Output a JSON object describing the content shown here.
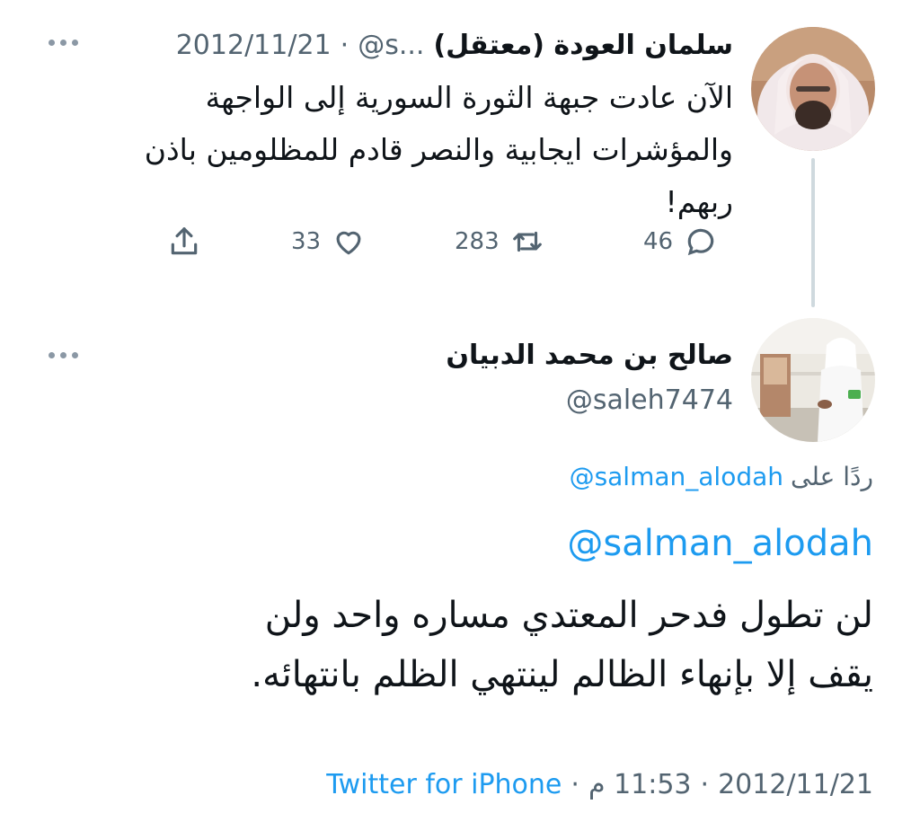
{
  "parent_tweet": {
    "display_name": "سلمان العودة (معتقل)",
    "handle": "@s...",
    "separator": "·",
    "date": "2012/11/21",
    "text_lines": [
      "الآن عادت جبهة الثورة السورية إلى الواجهة",
      "والمؤشرات ايجابية والنصر قادم للمظلومين باذن",
      "ربهم!"
    ],
    "replies": "46",
    "retweets": "283",
    "likes": "33"
  },
  "reply_tweet": {
    "display_name": "صالح بن محمد الدبيان",
    "handle": "@saleh7474",
    "replying_prefix": "ردًا على",
    "replying_to": "@salman_alodah",
    "mention": "@salman_alodah",
    "text_lines": [
      "لن تطول فدحر المعتدي مساره واحد ولن",
      "يقف إلا بإنهاء الظالم لينتهي الظلم بانتهائه."
    ],
    "meta": {
      "date": "2012/11/21",
      "time": "11:53 م",
      "sep1": "·",
      "sep2": "·",
      "source": "Twitter for iPhone"
    }
  },
  "colors": {
    "accent": "#1d9bf0",
    "muted": "#536471",
    "thread_line": "#cfd9de"
  },
  "icons": [
    "more-icon",
    "reply-icon",
    "retweet-icon",
    "like-icon",
    "share-icon"
  ]
}
